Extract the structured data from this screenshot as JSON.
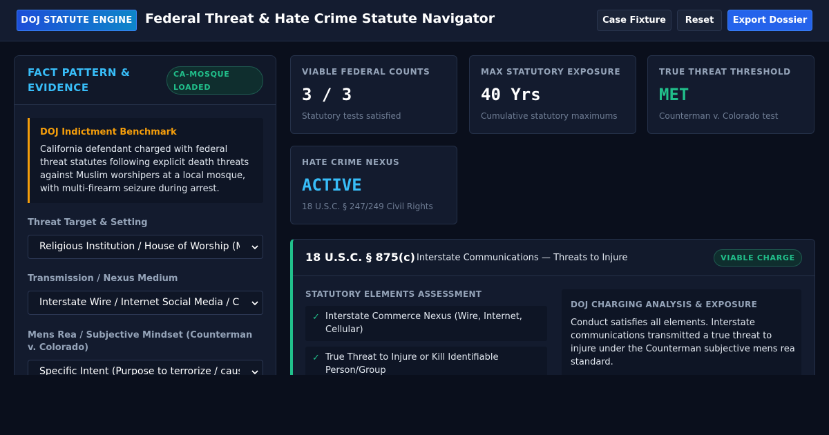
{
  "header": {
    "brand": "DOJ STATUTE ENGINE",
    "title": "Federal Threat & Hate Crime Statute Navigator",
    "buttons": {
      "case_fixture": "Case Fixture",
      "reset": "Reset",
      "export": "Export Dossier"
    }
  },
  "fact_panel": {
    "title": "FACT PATTERN & EVIDENCE",
    "badge": "CA-MOSQUE LOADED",
    "benchmark": {
      "title": "DOJ Indictment Benchmark",
      "text": "California defendant charged with federal threat statutes following explicit death threats against Muslim worshipers at a local mosque, with multi-firearm seizure during arrest."
    },
    "fields": [
      {
        "label": "Threat Target & Setting",
        "value": "Religious Institution / House of Worship (Mosque)"
      },
      {
        "label": "Transmission / Nexus Medium",
        "value": "Interstate Wire / Internet Social Media / Cellular"
      },
      {
        "label": "Mens Rea / Subjective Mindset (Counterman v. Colorado)",
        "value": "Specific Intent (Purpose to terrorize / cause fear)"
      }
    ]
  },
  "metrics": [
    {
      "label": "VIABLE FEDERAL COUNTS",
      "value": "3 / 3",
      "sub": "Statutory tests satisfied",
      "tone": "white"
    },
    {
      "label": "MAX STATUTORY EXPOSURE",
      "value": "40 Yrs",
      "sub": "Cumulative statutory maximums",
      "tone": "white"
    },
    {
      "label": "TRUE THREAT THRESHOLD",
      "value": "MET",
      "sub": "Counterman v. Colorado test",
      "tone": "green"
    },
    {
      "label": "HATE CRIME NEXUS",
      "value": "ACTIVE",
      "sub": "18 U.S.C. § 247/249 Civil Rights",
      "tone": "blue"
    }
  ],
  "statute": {
    "code": "18 U.S.C. § 875(c)",
    "name": "Interstate Communications — Threats to Injure",
    "badge": "VIABLE CHARGE",
    "elements_heading": "STATUTORY ELEMENTS ASSESSMENT",
    "elements": [
      {
        "check": "✓",
        "text": "Interstate Commerce Nexus (Wire, Internet, Cellular)"
      },
      {
        "check": "✓",
        "text": "True Threat to Injure or Kill Identifiable Person/Group"
      }
    ],
    "analysis_heading": "DOJ CHARGING ANALYSIS & EXPOSURE",
    "analysis_text": "Conduct satisfies all elements. Interstate communications transmitted a true threat to injure under the Counterman subjective mens rea standard."
  },
  "colors": {
    "accent_blue": "#38bdf8",
    "accent_green": "#21c08b",
    "accent_amber": "#f59e0b",
    "primary_button": "#2563eb"
  },
  "icons": {
    "select_chevron": "chevron-down-icon",
    "element_check": "check-icon"
  }
}
